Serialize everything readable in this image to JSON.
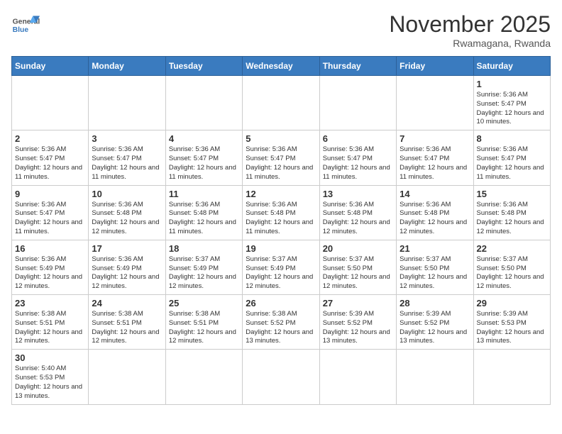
{
  "header": {
    "logo_general": "General",
    "logo_blue": "Blue",
    "month_title": "November 2025",
    "location": "Rwamagana, Rwanda"
  },
  "weekdays": [
    "Sunday",
    "Monday",
    "Tuesday",
    "Wednesday",
    "Thursday",
    "Friday",
    "Saturday"
  ],
  "days": {
    "d1": {
      "num": "1",
      "sunrise": "Sunrise: 5:36 AM",
      "sunset": "Sunset: 5:47 PM",
      "daylight": "Daylight: 12 hours and 10 minutes."
    },
    "d2": {
      "num": "2",
      "sunrise": "Sunrise: 5:36 AM",
      "sunset": "Sunset: 5:47 PM",
      "daylight": "Daylight: 12 hours and 11 minutes."
    },
    "d3": {
      "num": "3",
      "sunrise": "Sunrise: 5:36 AM",
      "sunset": "Sunset: 5:47 PM",
      "daylight": "Daylight: 12 hours and 11 minutes."
    },
    "d4": {
      "num": "4",
      "sunrise": "Sunrise: 5:36 AM",
      "sunset": "Sunset: 5:47 PM",
      "daylight": "Daylight: 12 hours and 11 minutes."
    },
    "d5": {
      "num": "5",
      "sunrise": "Sunrise: 5:36 AM",
      "sunset": "Sunset: 5:47 PM",
      "daylight": "Daylight: 12 hours and 11 minutes."
    },
    "d6": {
      "num": "6",
      "sunrise": "Sunrise: 5:36 AM",
      "sunset": "Sunset: 5:47 PM",
      "daylight": "Daylight: 12 hours and 11 minutes."
    },
    "d7": {
      "num": "7",
      "sunrise": "Sunrise: 5:36 AM",
      "sunset": "Sunset: 5:47 PM",
      "daylight": "Daylight: 12 hours and 11 minutes."
    },
    "d8": {
      "num": "8",
      "sunrise": "Sunrise: 5:36 AM",
      "sunset": "Sunset: 5:47 PM",
      "daylight": "Daylight: 12 hours and 11 minutes."
    },
    "d9": {
      "num": "9",
      "sunrise": "Sunrise: 5:36 AM",
      "sunset": "Sunset: 5:47 PM",
      "daylight": "Daylight: 12 hours and 11 minutes."
    },
    "d10": {
      "num": "10",
      "sunrise": "Sunrise: 5:36 AM",
      "sunset": "Sunset: 5:48 PM",
      "daylight": "Daylight: 12 hours and 12 minutes."
    },
    "d11": {
      "num": "11",
      "sunrise": "Sunrise: 5:36 AM",
      "sunset": "Sunset: 5:48 PM",
      "daylight": "Daylight: 12 hours and 11 minutes."
    },
    "d12": {
      "num": "12",
      "sunrise": "Sunrise: 5:36 AM",
      "sunset": "Sunset: 5:48 PM",
      "daylight": "Daylight: 12 hours and 11 minutes."
    },
    "d13": {
      "num": "13",
      "sunrise": "Sunrise: 5:36 AM",
      "sunset": "Sunset: 5:48 PM",
      "daylight": "Daylight: 12 hours and 12 minutes."
    },
    "d14": {
      "num": "14",
      "sunrise": "Sunrise: 5:36 AM",
      "sunset": "Sunset: 5:48 PM",
      "daylight": "Daylight: 12 hours and 12 minutes."
    },
    "d15": {
      "num": "15",
      "sunrise": "Sunrise: 5:36 AM",
      "sunset": "Sunset: 5:48 PM",
      "daylight": "Daylight: 12 hours and 12 minutes."
    },
    "d16": {
      "num": "16",
      "sunrise": "Sunrise: 5:36 AM",
      "sunset": "Sunset: 5:49 PM",
      "daylight": "Daylight: 12 hours and 12 minutes."
    },
    "d17": {
      "num": "17",
      "sunrise": "Sunrise: 5:36 AM",
      "sunset": "Sunset: 5:49 PM",
      "daylight": "Daylight: 12 hours and 12 minutes."
    },
    "d18": {
      "num": "18",
      "sunrise": "Sunrise: 5:37 AM",
      "sunset": "Sunset: 5:49 PM",
      "daylight": "Daylight: 12 hours and 12 minutes."
    },
    "d19": {
      "num": "19",
      "sunrise": "Sunrise: 5:37 AM",
      "sunset": "Sunset: 5:49 PM",
      "daylight": "Daylight: 12 hours and 12 minutes."
    },
    "d20": {
      "num": "20",
      "sunrise": "Sunrise: 5:37 AM",
      "sunset": "Sunset: 5:50 PM",
      "daylight": "Daylight: 12 hours and 12 minutes."
    },
    "d21": {
      "num": "21",
      "sunrise": "Sunrise: 5:37 AM",
      "sunset": "Sunset: 5:50 PM",
      "daylight": "Daylight: 12 hours and 12 minutes."
    },
    "d22": {
      "num": "22",
      "sunrise": "Sunrise: 5:37 AM",
      "sunset": "Sunset: 5:50 PM",
      "daylight": "Daylight: 12 hours and 12 minutes."
    },
    "d23": {
      "num": "23",
      "sunrise": "Sunrise: 5:38 AM",
      "sunset": "Sunset: 5:51 PM",
      "daylight": "Daylight: 12 hours and 12 minutes."
    },
    "d24": {
      "num": "24",
      "sunrise": "Sunrise: 5:38 AM",
      "sunset": "Sunset: 5:51 PM",
      "daylight": "Daylight: 12 hours and 12 minutes."
    },
    "d25": {
      "num": "25",
      "sunrise": "Sunrise: 5:38 AM",
      "sunset": "Sunset: 5:51 PM",
      "daylight": "Daylight: 12 hours and 12 minutes."
    },
    "d26": {
      "num": "26",
      "sunrise": "Sunrise: 5:38 AM",
      "sunset": "Sunset: 5:52 PM",
      "daylight": "Daylight: 12 hours and 13 minutes."
    },
    "d27": {
      "num": "27",
      "sunrise": "Sunrise: 5:39 AM",
      "sunset": "Sunset: 5:52 PM",
      "daylight": "Daylight: 12 hours and 13 minutes."
    },
    "d28": {
      "num": "28",
      "sunrise": "Sunrise: 5:39 AM",
      "sunset": "Sunset: 5:52 PM",
      "daylight": "Daylight: 12 hours and 13 minutes."
    },
    "d29": {
      "num": "29",
      "sunrise": "Sunrise: 5:39 AM",
      "sunset": "Sunset: 5:53 PM",
      "daylight": "Daylight: 12 hours and 13 minutes."
    },
    "d30": {
      "num": "30",
      "sunrise": "Sunrise: 5:40 AM",
      "sunset": "Sunset: 5:53 PM",
      "daylight": "Daylight: 12 hours and 13 minutes."
    }
  }
}
